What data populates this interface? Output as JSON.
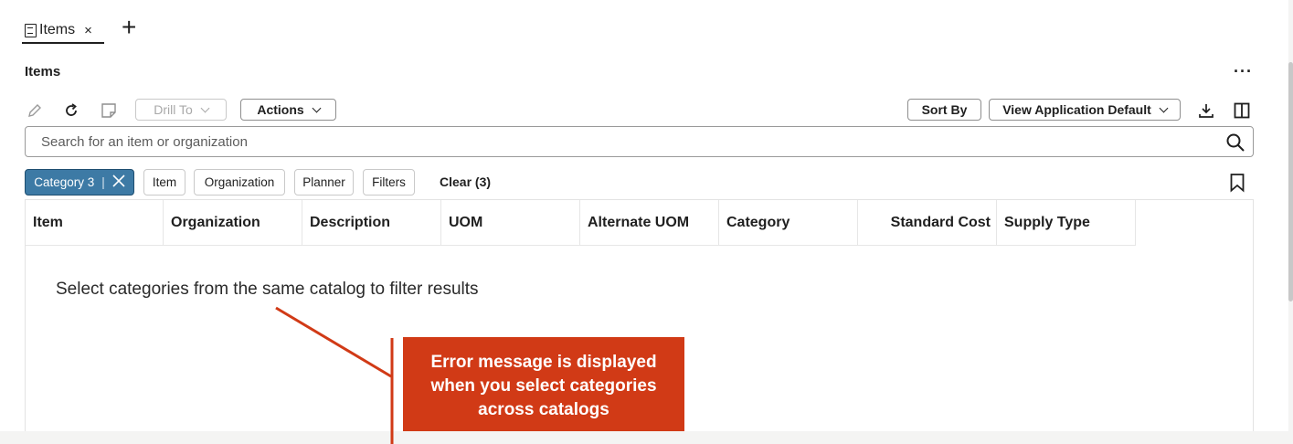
{
  "tab": {
    "label": "Items",
    "close": "×",
    "add": "+"
  },
  "page": {
    "title": "Items",
    "more": "···"
  },
  "toolbar": {
    "drill_to": "Drill To",
    "actions": "Actions",
    "sort_by": "Sort By",
    "view": "View Application Default"
  },
  "search": {
    "placeholder": "Search for an item or organization"
  },
  "filters": {
    "active_chip": "Category 3",
    "chip_separator": "|",
    "chips": [
      "Item",
      "Organization",
      "Planner",
      "Filters"
    ],
    "clear": "Clear (3)"
  },
  "table": {
    "columns": [
      "Item",
      "Organization",
      "Description",
      "UOM",
      "Alternate UOM",
      "Category",
      "Standard Cost",
      "Supply Type"
    ],
    "empty_message": "Select categories from the same catalog to filter results"
  },
  "callout": {
    "lines": [
      "Error message is displayed",
      "when you select categories",
      "across catalogs"
    ]
  },
  "colors": {
    "accent_chip": "#3d7aa5",
    "callout": "#d13a16"
  }
}
